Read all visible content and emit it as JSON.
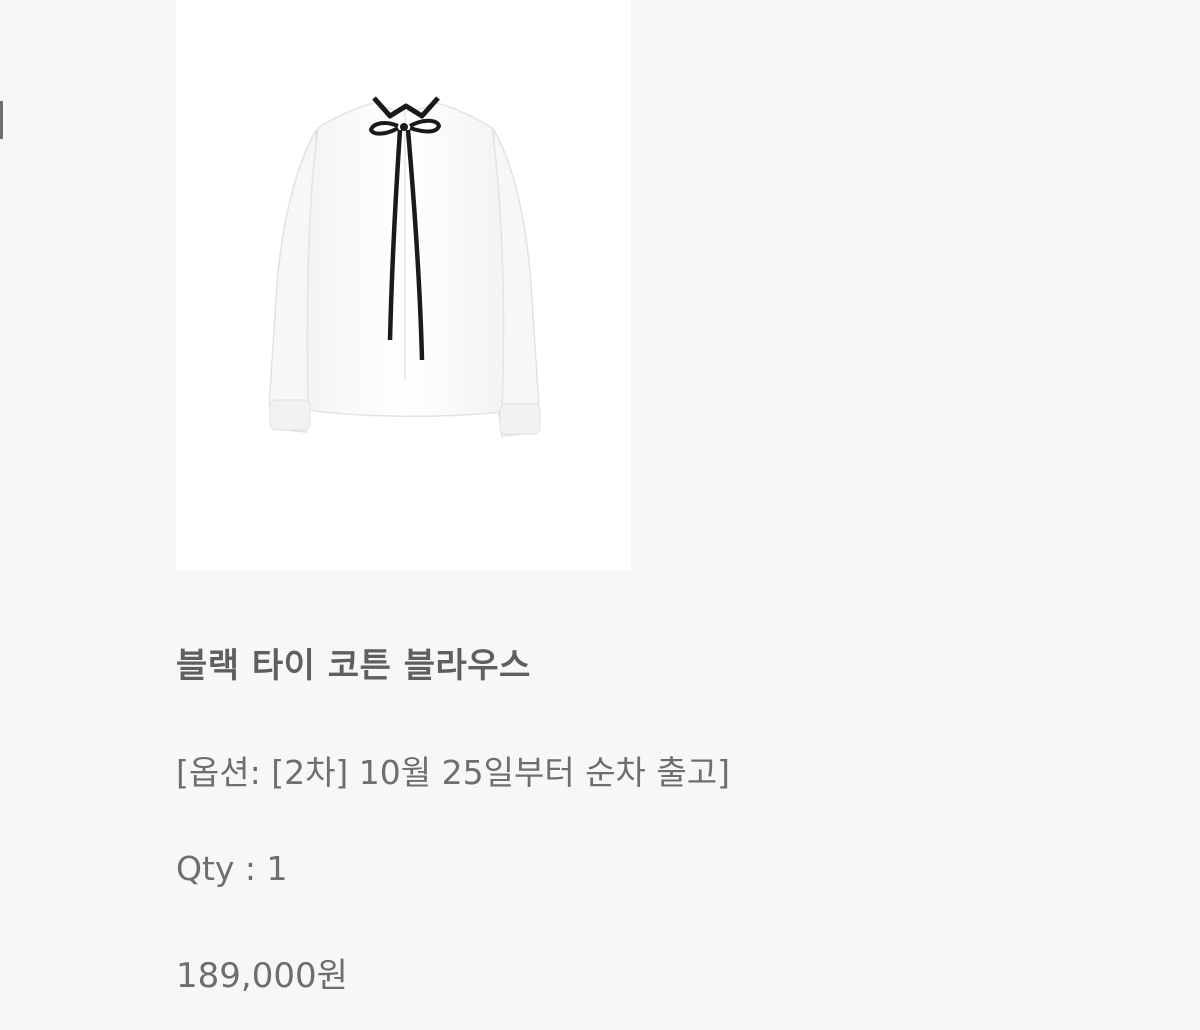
{
  "product": {
    "name": "블랙 타이 코튼 블라우스",
    "option": "[옵션: [2차] 10월 25일부터 순차 출고]",
    "qty": "Qty : 1",
    "price": "189,000원"
  },
  "icons": {
    "product_image": "white-blouse-with-black-ribbon-tie"
  }
}
